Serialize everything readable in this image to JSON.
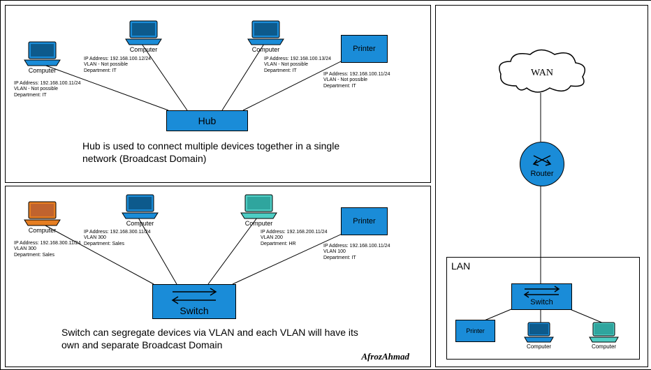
{
  "signature": "AfrozAhmad",
  "labels": {
    "computer": "Computer",
    "printer": "Printer",
    "hub": "Hub",
    "switch": "Switch",
    "router": "Router",
    "wan": "WAN",
    "lan": "LAN"
  },
  "hub_panel": {
    "caption": "Hub is used to connect multiple devices together in a single network (Broadcast Domain)",
    "devices": {
      "pc1": {
        "color": "blue",
        "details": "IP Address: 192.168.100.11/24\nVLAN - Not possible\nDepartment: IT"
      },
      "pc2": {
        "color": "blue",
        "details": "IP Address: 192.168.100.12/24\nVLAN - Not possible\nDepartment: IT"
      },
      "pc3": {
        "color": "blue",
        "details": "IP Address: 192.168.100.13/24\nVLAN - Not possible\nDepartment: IT"
      },
      "printer": {
        "details": "IP Address: 192.168.100.11/24\nVLAN - Not possible\nDepartment: IT"
      }
    }
  },
  "switch_panel": {
    "caption": "Switch can segregate devices via VLAN and each VLAN will have its own and separate Broadcast Domain",
    "devices": {
      "pc1": {
        "color": "orange",
        "details": "IP Address: 192.168.300.11/24\nVLAN 300\nDepartment: Sales"
      },
      "pc2": {
        "color": "blue",
        "details": "IP Address: 192.168.300.11/24\nVLAN 300\nDepartment: Sales"
      },
      "pc3": {
        "color": "teal",
        "details": "IP Address: 192.168.200.11/24\nVLAN 200\nDepartment: HR"
      },
      "printer": {
        "details": "IP Address: 192.168.100.11/24\nVLAN 100\nDepartment: IT"
      }
    }
  },
  "wan_panel": {
    "lan_devices": {
      "printer": {},
      "pc1": {
        "color": "blue"
      },
      "pc2": {
        "color": "teal"
      }
    }
  },
  "colors": {
    "blue": "#1a8cd8",
    "orange": "#e67e22",
    "teal": "#4ecdc4"
  }
}
